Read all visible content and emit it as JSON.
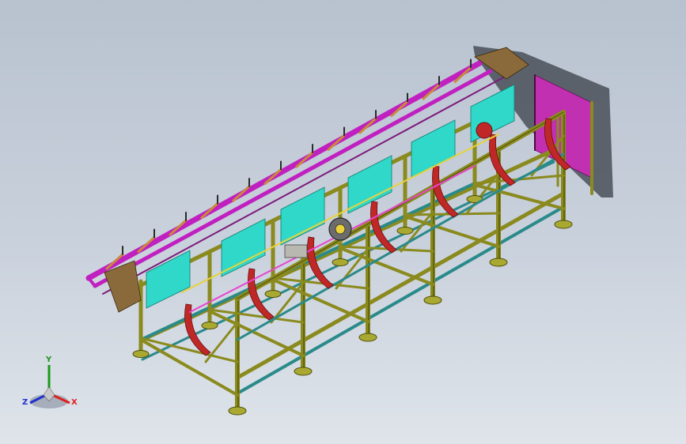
{
  "triad": {
    "x_label": "X",
    "y_label": "Y",
    "z_label": "Z",
    "x_color": "#e02020",
    "y_color": "#1a9a1a",
    "z_color": "#2030d0"
  },
  "colors": {
    "frame": "#8a8a1e",
    "frame_dark": "#4e4e0c",
    "rail": "#c020c0",
    "crossbar": "#2a8a8a",
    "panel": "#2fd8c8",
    "guard": "#c030b0",
    "belt": "#c02828",
    "base": "#a9a932"
  }
}
